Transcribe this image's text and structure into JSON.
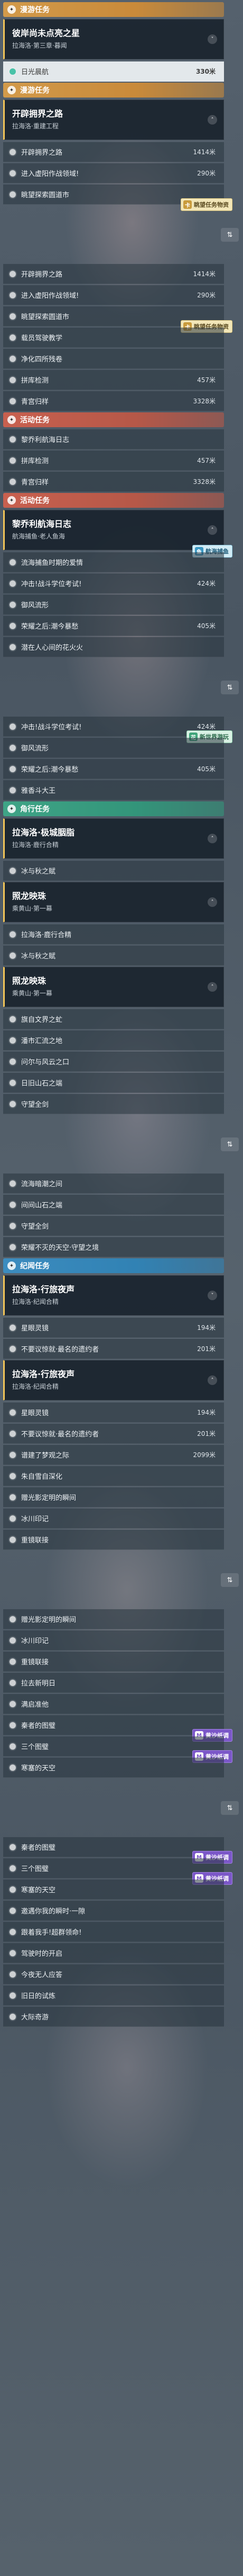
{
  "rows": [
    {
      "kind": "cat",
      "color": "orange",
      "label": "漫游任务"
    },
    {
      "kind": "task",
      "title": "彼岸尚未点亮之星",
      "subtitle": "拉海洛·第三章·暮闻",
      "chev": "˅"
    },
    {
      "kind": "step",
      "style": "hl",
      "label": "日光晨航",
      "dist": "330米"
    },
    {
      "kind": "cat",
      "color": "orange",
      "label": "漫游任务"
    },
    {
      "kind": "task",
      "title": "开辟拥界之路",
      "subtitle": "拉海洛·重建工程",
      "chev": "˄"
    },
    {
      "kind": "step",
      "label": "开辟拥界之路",
      "dist": "1414米"
    },
    {
      "kind": "step",
      "label": "进入虚阳作战领域!",
      "dist": "290米"
    },
    {
      "kind": "step",
      "label": "眺望探索圆道市",
      "dist": "",
      "badge": {
        "style": "b-yellow",
        "icon": "卡",
        "text": "眺望任务物资"
      }
    },
    {
      "kind": "gap"
    },
    {
      "kind": "step",
      "label": "开辟拥界之路",
      "dist": "1414米"
    },
    {
      "kind": "step",
      "label": "进入虚阳作战领域!",
      "dist": "290米"
    },
    {
      "kind": "step",
      "label": "眺望探索圆道市",
      "dist": "",
      "badge": {
        "style": "b-yellow",
        "icon": "卡",
        "text": "眺望任务物资"
      }
    },
    {
      "kind": "step",
      "label": "载员驾驶教学",
      "dist": ""
    },
    {
      "kind": "step",
      "label": "净化四所残卷",
      "dist": ""
    },
    {
      "kind": "step",
      "label": "拼库检测",
      "dist": "457米"
    },
    {
      "kind": "step",
      "label": "青宫归样",
      "dist": "3328米"
    },
    {
      "kind": "cat",
      "color": "red",
      "label": "活动任务"
    },
    {
      "kind": "step",
      "label": "黎乔利航海日志",
      "dist": ""
    },
    {
      "kind": "step",
      "label": "拼库检测",
      "dist": "457米"
    },
    {
      "kind": "step",
      "label": "青宫归样",
      "dist": "3328米"
    },
    {
      "kind": "cat",
      "color": "red",
      "label": "活动任务"
    },
    {
      "kind": "task",
      "title": "黎乔利航海日志",
      "subtitle": "航海捕鱼·老人鱼海",
      "chev": "˄",
      "badge": {
        "style": "b-blue",
        "icon": "鱼",
        "text": "航海捕鱼"
      }
    },
    {
      "kind": "step",
      "label": "流海捕鱼时期的爱情",
      "dist": ""
    },
    {
      "kind": "step",
      "label": "冲击!战斗学位考试!",
      "dist": "424米"
    },
    {
      "kind": "step",
      "label": "御风流形",
      "dist": ""
    },
    {
      "kind": "step",
      "label": "荣耀之后:潮今暴愁",
      "dist": "405米"
    },
    {
      "kind": "step",
      "label": "潜在人心间的花火火",
      "dist": ""
    },
    {
      "kind": "gap"
    },
    {
      "kind": "step",
      "label": "冲击!战斗学位考试!",
      "dist": "424米",
      "badge": {
        "style": "b-green",
        "icon": "花",
        "text": "新世界游玩"
      }
    },
    {
      "kind": "step",
      "label": "御风流形",
      "dist": ""
    },
    {
      "kind": "step",
      "label": "荣耀之后:潮今暴愁",
      "dist": "405米"
    },
    {
      "kind": "step",
      "label": "雅香斗大王",
      "dist": ""
    },
    {
      "kind": "cat",
      "color": "green",
      "label": "角行任务"
    },
    {
      "kind": "task",
      "title": "拉海洛·极城胭脂",
      "subtitle": "拉海洛·鹿行合精",
      "chev": "˄"
    },
    {
      "kind": "step",
      "label": "冰与秋之赋",
      "dist": ""
    },
    {
      "kind": "task",
      "title": "照龙映珠",
      "subtitle": "乘黄山·第一幕",
      "chev": "˄"
    },
    {
      "kind": "step",
      "label": "拉海洛·鹿行合精",
      "dist": ""
    },
    {
      "kind": "step",
      "label": "冰与秋之赋",
      "dist": ""
    },
    {
      "kind": "task",
      "title": "照龙映珠",
      "subtitle": "乘黄山·第一幕",
      "chev": "˄"
    },
    {
      "kind": "step",
      "label": "旗自文界之虻",
      "dist": ""
    },
    {
      "kind": "step",
      "label": "潘市汇流之地",
      "dist": ""
    },
    {
      "kind": "step",
      "label": "问尔与风云之口",
      "dist": ""
    },
    {
      "kind": "step",
      "label": "日旧山石之端",
      "dist": ""
    },
    {
      "kind": "step",
      "label": "守望全剑",
      "dist": ""
    },
    {
      "kind": "gap"
    },
    {
      "kind": "step",
      "label": "流海暗潮之间",
      "dist": ""
    },
    {
      "kind": "step",
      "label": "间间山石之端",
      "dist": ""
    },
    {
      "kind": "step",
      "label": "守望全剑",
      "dist": ""
    },
    {
      "kind": "step",
      "label": "荣耀不灭的天空·守望之境",
      "dist": ""
    },
    {
      "kind": "cat",
      "color": "blue",
      "label": "纪闻任务"
    },
    {
      "kind": "task",
      "title": "拉海洛·行旅夜声",
      "subtitle": "拉海洛·纪闻合精",
      "chev": "˅"
    },
    {
      "kind": "step",
      "label": "星眼灵镜",
      "dist": "194米"
    },
    {
      "kind": "step",
      "label": "不要议惊就·最名的遗约者",
      "dist": "201米"
    },
    {
      "kind": "task",
      "title": "拉海洛·行旅夜声",
      "subtitle": "拉海洛·纪闻合精",
      "chev": "˄"
    },
    {
      "kind": "step",
      "label": "星眼灵镜",
      "dist": "194米"
    },
    {
      "kind": "step",
      "label": "不要议惊就·最名的遗约者",
      "dist": "201米"
    },
    {
      "kind": "step",
      "label": "谱建了梦观之际",
      "dist": "2099米"
    },
    {
      "kind": "step",
      "label": "朱自雪自深化",
      "dist": ""
    },
    {
      "kind": "step",
      "label": "赠光影定明的瞬间",
      "dist": ""
    },
    {
      "kind": "step",
      "label": "冰川印记",
      "dist": ""
    },
    {
      "kind": "step",
      "label": "重镜联接",
      "dist": ""
    },
    {
      "kind": "gap"
    },
    {
      "kind": "step",
      "label": "赠光影定明的瞬间",
      "dist": ""
    },
    {
      "kind": "step",
      "label": "冰川印记",
      "dist": ""
    },
    {
      "kind": "step",
      "label": "重镜联接",
      "dist": ""
    },
    {
      "kind": "step",
      "label": "拉去新明日",
      "dist": ""
    },
    {
      "kind": "step",
      "label": "满启准他",
      "dist": ""
    },
    {
      "kind": "step",
      "label": "秦者的图璧",
      "dist": "",
      "badge": {
        "style": "b-purple",
        "icon": "M",
        "text": "黄沙纸调"
      }
    },
    {
      "kind": "step",
      "label": "三个图璧",
      "dist": "",
      "badge": {
        "style": "b-purple",
        "icon": "M",
        "text": "黄沙纸调"
      }
    },
    {
      "kind": "step",
      "label": "寒塞的天空",
      "dist": ""
    },
    {
      "kind": "gap"
    },
    {
      "kind": "step",
      "label": "秦者的图璧",
      "dist": "",
      "badge": {
        "style": "b-purple",
        "icon": "M",
        "text": "黄沙纸调"
      }
    },
    {
      "kind": "step",
      "label": "三个图璧",
      "dist": "",
      "badge": {
        "style": "b-purple",
        "icon": "M",
        "text": "黄沙纸调"
      }
    },
    {
      "kind": "step",
      "label": "寒塞的天空",
      "dist": ""
    },
    {
      "kind": "step",
      "label": "邀遇你我的瞬时·一隙",
      "dist": ""
    },
    {
      "kind": "step",
      "label": "跟着我手!超群领命!",
      "dist": ""
    },
    {
      "kind": "step",
      "label": "驾驶时的开启",
      "dist": ""
    },
    {
      "kind": "step",
      "label": "今夜无人应答",
      "dist": ""
    },
    {
      "kind": "step",
      "label": "旧日的试炼",
      "dist": ""
    },
    {
      "kind": "step",
      "label": "大际奇游",
      "dist": ""
    }
  ]
}
